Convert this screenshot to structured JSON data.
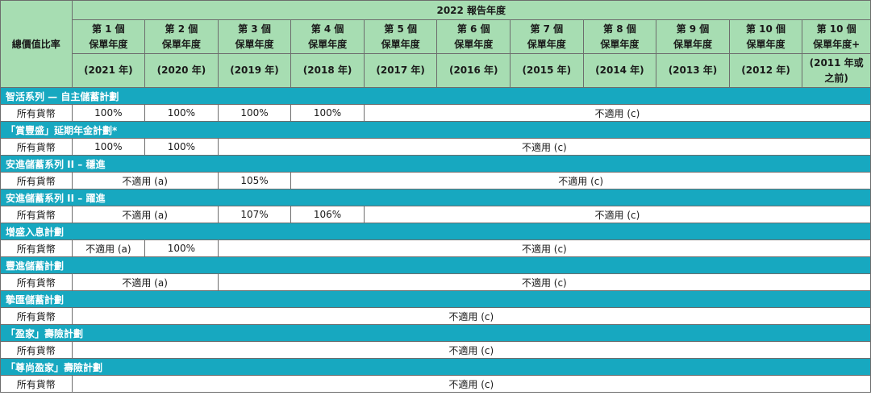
{
  "header": {
    "corner": "總價值比率",
    "report_year": "2022 報告年度",
    "columns": [
      {
        "line1": "第 1 個",
        "line2": "保單年度",
        "line3": "(2021 年)"
      },
      {
        "line1": "第 2 個",
        "line2": "保單年度",
        "line3": "(2020 年)"
      },
      {
        "line1": "第 3 個",
        "line2": "保單年度",
        "line3": "(2019 年)"
      },
      {
        "line1": "第 4 個",
        "line2": "保單年度",
        "line3": "(2018 年)"
      },
      {
        "line1": "第 5 個",
        "line2": "保單年度",
        "line3": "(2017 年)"
      },
      {
        "line1": "第 6 個",
        "line2": "保單年度",
        "line3": "(2016 年)"
      },
      {
        "line1": "第 7 個",
        "line2": "保單年度",
        "line3": "(2015 年)"
      },
      {
        "line1": "第 8 個",
        "line2": "保單年度",
        "line3": "(2014 年)"
      },
      {
        "line1": "第 9 個",
        "line2": "保單年度",
        "line3": "(2013 年)"
      },
      {
        "line1": "第 10 個",
        "line2": "保單年度",
        "line3": "(2012 年)"
      },
      {
        "line1": "第 10 個",
        "line2": "保單年度+",
        "line3a": "(2011 年或",
        "line3b": "之前)"
      }
    ]
  },
  "sections": [
    {
      "title": "智活系列 — 自主儲蓄計劃",
      "row_label": "所有貨幣",
      "cells": [
        "100%",
        "100%",
        "100%",
        "100%",
        "不適用 (c)"
      ]
    },
    {
      "title": "「賞豐盛」延期年金計劃*",
      "row_label": "所有貨幣",
      "cells": [
        "100%",
        "100%",
        "不適用 (c)"
      ]
    },
    {
      "title": "安進儲蓄系列 II – 穩進",
      "row_label": "所有貨幣",
      "cells": [
        "不適用 (a)",
        "105%",
        "不適用 (c)"
      ]
    },
    {
      "title": "安進儲蓄系列 II –  躍進",
      "row_label": "所有貨幣",
      "cells": [
        "不適用 (a)",
        "107%",
        "106%",
        "不適用 (c)"
      ]
    },
    {
      "title": "增盛入息計劃",
      "row_label": "所有貨幣",
      "cells": [
        "不適用 (a)",
        "100%",
        "不適用 (c)"
      ]
    },
    {
      "title": "豐進儲蓄計劃",
      "row_label": "所有貨幣",
      "cells": [
        "不適用 (a)",
        "不適用 (c)"
      ]
    },
    {
      "title": "摯匯儲蓄計劃",
      "row_label": "所有貨幣",
      "cells": [
        "不適用 (c)"
      ]
    },
    {
      "title": "「盈家」壽險計劃",
      "row_label": "所有貨幣",
      "cells": [
        "不適用 (c)"
      ]
    },
    {
      "title": "「尊尚盈家」壽險計劃",
      "row_label": "所有貨幣",
      "cells": [
        "不適用 (c)"
      ]
    }
  ],
  "colors": {
    "header_green": "#a7ddb2",
    "section_teal": "#17a8c0"
  }
}
